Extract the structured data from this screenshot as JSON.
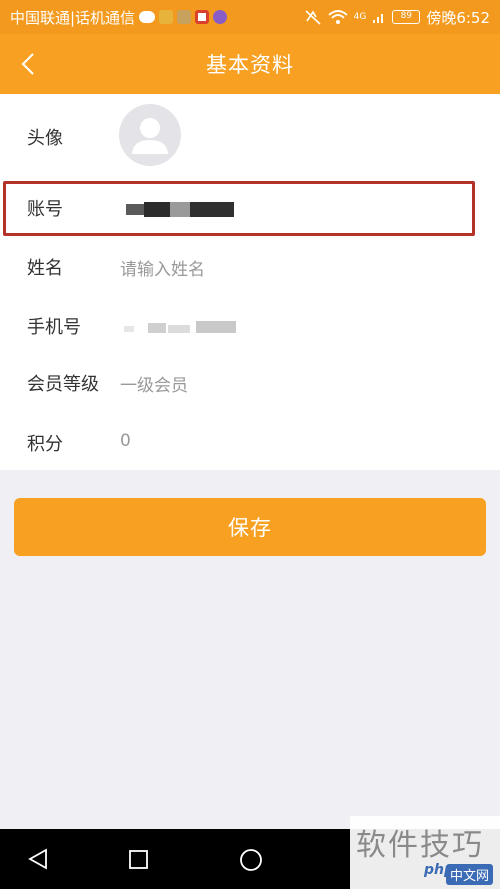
{
  "status_bar": {
    "carrier": "中国联通|话机通信",
    "time": "傍晚6:52",
    "battery": "89",
    "signal": "4G"
  },
  "header": {
    "title": "基本资料",
    "back_icon": "chevron-left-icon"
  },
  "profile": {
    "rows": [
      {
        "label": "头像",
        "value": ""
      },
      {
        "label": "账号",
        "value": ""
      },
      {
        "label": "姓名",
        "value": "",
        "placeholder": "请输入姓名"
      },
      {
        "label": "手机号",
        "value": ""
      },
      {
        "label": "会员等级",
        "value": "一级会员"
      },
      {
        "label": "积分",
        "value": "0"
      }
    ]
  },
  "actions": {
    "save_label": "保存"
  },
  "watermark": {
    "text": "软件技巧",
    "logo": "中文网",
    "php": "php"
  },
  "colors": {
    "accent": "#f7a022",
    "highlight": "#b3322a",
    "background": "#f0f0f4"
  }
}
